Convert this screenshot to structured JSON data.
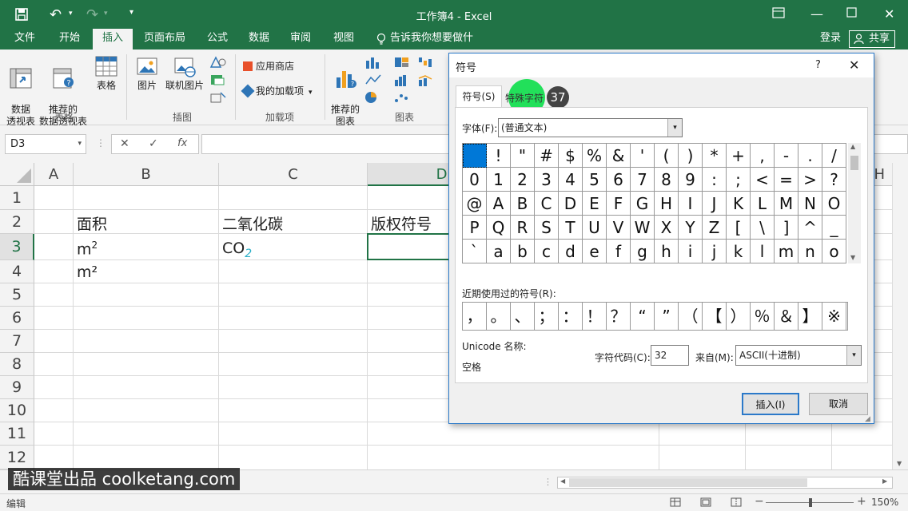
{
  "titlebar": {
    "window_title": "工作簿4 - Excel",
    "save_icon": "save-icon",
    "undo_icon": "undo-icon",
    "redo_icon": "redo-icon",
    "qat_more": "▾"
  },
  "tabs": {
    "file": "文件",
    "home": "开始",
    "insert": "插入",
    "page_layout": "页面布局",
    "formulas": "公式",
    "data": "数据",
    "review": "审阅",
    "view": "视图",
    "tell_me": "告诉我你想要做什么",
    "login": "登录",
    "share": "共享"
  },
  "ribbon": {
    "pivot": "数据\n透视表",
    "recommended_pivot": "推荐的\n数据透视表",
    "table": "表格",
    "group_tables": "表格",
    "pictures": "图片",
    "online_pictures": "联机图片",
    "group_illustrations": "插图",
    "store": "应用商店",
    "my_addins": "我的加载项",
    "group_addins": "加载项",
    "recommended_charts": "推荐的\n图表",
    "group_charts": "图表"
  },
  "formula_bar": {
    "name_box": "D3",
    "cancel": "✕",
    "enter": "✓",
    "fx": "fx",
    "formula": ""
  },
  "grid": {
    "columns": [
      "A",
      "B",
      "C",
      "D",
      "H"
    ],
    "rows": [
      "1",
      "2",
      "3",
      "4",
      "5",
      "6",
      "7",
      "8",
      "9",
      "10",
      "11",
      "12"
    ],
    "B2": "面积",
    "C2": "二氧化碳",
    "D2": "版权符号",
    "B3_base": "m",
    "B3_sup": "2",
    "C3_base": "CO",
    "C3_sub": "2",
    "B4": "m²"
  },
  "dialog": {
    "title": "符号",
    "help": "?",
    "close": "✕",
    "tab_symbols": "符号(S)",
    "tab_special": "特殊字符",
    "step_badge": "37",
    "font_label": "字体(F):",
    "font_value": "(普通文本)",
    "symbol_rows": [
      [
        " ",
        "!",
        "\"",
        "#",
        "$",
        "%",
        "&",
        "'",
        "(",
        ")",
        "*",
        "+",
        ",",
        "-",
        ".",
        "/"
      ],
      [
        "0",
        "1",
        "2",
        "3",
        "4",
        "5",
        "6",
        "7",
        "8",
        "9",
        ":",
        ";",
        "<",
        "=",
        ">",
        "?"
      ],
      [
        "@",
        "A",
        "B",
        "C",
        "D",
        "E",
        "F",
        "G",
        "H",
        "I",
        "J",
        "K",
        "L",
        "M",
        "N",
        "O"
      ],
      [
        "P",
        "Q",
        "R",
        "S",
        "T",
        "U",
        "V",
        "W",
        "X",
        "Y",
        "Z",
        "[",
        "\\",
        "]",
        "^",
        "_"
      ],
      [
        "`",
        "a",
        "b",
        "c",
        "d",
        "e",
        "f",
        "g",
        "h",
        "i",
        "j",
        "k",
        "l",
        "m",
        "n",
        "o"
      ]
    ],
    "recent_label": "近期使用过的符号(R):",
    "recent_symbols": [
      "，",
      "。",
      "、",
      "；",
      "：",
      "！",
      "？",
      "“",
      "”",
      "（",
      "【",
      "）",
      "％",
      "＆",
      "】",
      "※"
    ],
    "unicode_label": "Unicode 名称:",
    "unicode_value": "空格",
    "char_code_label": "字符代码(C):",
    "char_code_value": "32",
    "from_label": "来自(M):",
    "from_value": "ASCII(十进制)",
    "insert_button": "插入(I)",
    "cancel_button": "取消"
  },
  "status": {
    "mode": "编辑",
    "zoom": "150%"
  },
  "watermark": "酷课堂出品 coolketang.com",
  "colors": {
    "excel_green": "#217346",
    "selection": "#0078d7",
    "highlight": "#22e05a"
  }
}
